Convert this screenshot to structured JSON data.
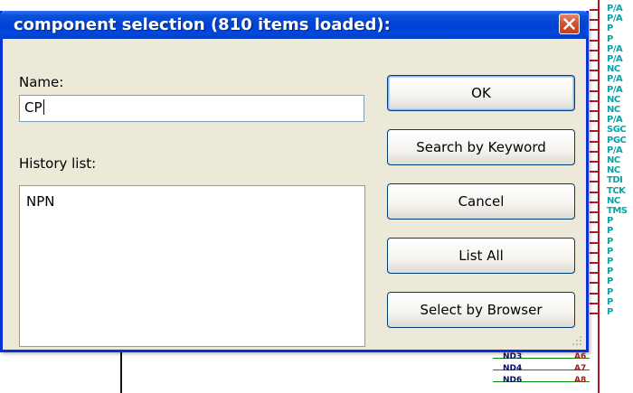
{
  "window": {
    "title": "component selection (810 items loaded):",
    "close_icon": "close-icon"
  },
  "name_field": {
    "label": "Name:",
    "value": "CP"
  },
  "history": {
    "label": "History list:",
    "items": [
      "NPN"
    ]
  },
  "buttons": {
    "ok": "OK",
    "search_by_keyword": "Search by Keyword",
    "cancel": "Cancel",
    "list_all": "List All",
    "select_by_browser": "Select by Browser"
  },
  "schematic": {
    "pin_labels": [
      "P/A",
      "P/A",
      "P",
      "P",
      "P/A",
      "P/A",
      "NC",
      "P/A",
      "P/A",
      "NC",
      "NC",
      "P/A",
      "SGC",
      "PGC",
      "P/A",
      "NC",
      "NC",
      "TDI",
      "TCK",
      "NC",
      "TMS",
      "P",
      "P",
      "P",
      "P",
      "P",
      "P",
      "P",
      "P",
      "P",
      "P"
    ],
    "nets": [
      {
        "name": "ND3",
        "pin": "A6"
      },
      {
        "name": "ND4",
        "pin": "A7"
      },
      {
        "name": "ND6",
        "pin": "A8"
      }
    ],
    "colors": {
      "pin_text": "#0aa3a3",
      "pin_line": "#b4141e",
      "net_line": "#0a8a0a",
      "title_bar": "#0042d4",
      "window_bg": "#ece9d8"
    }
  }
}
